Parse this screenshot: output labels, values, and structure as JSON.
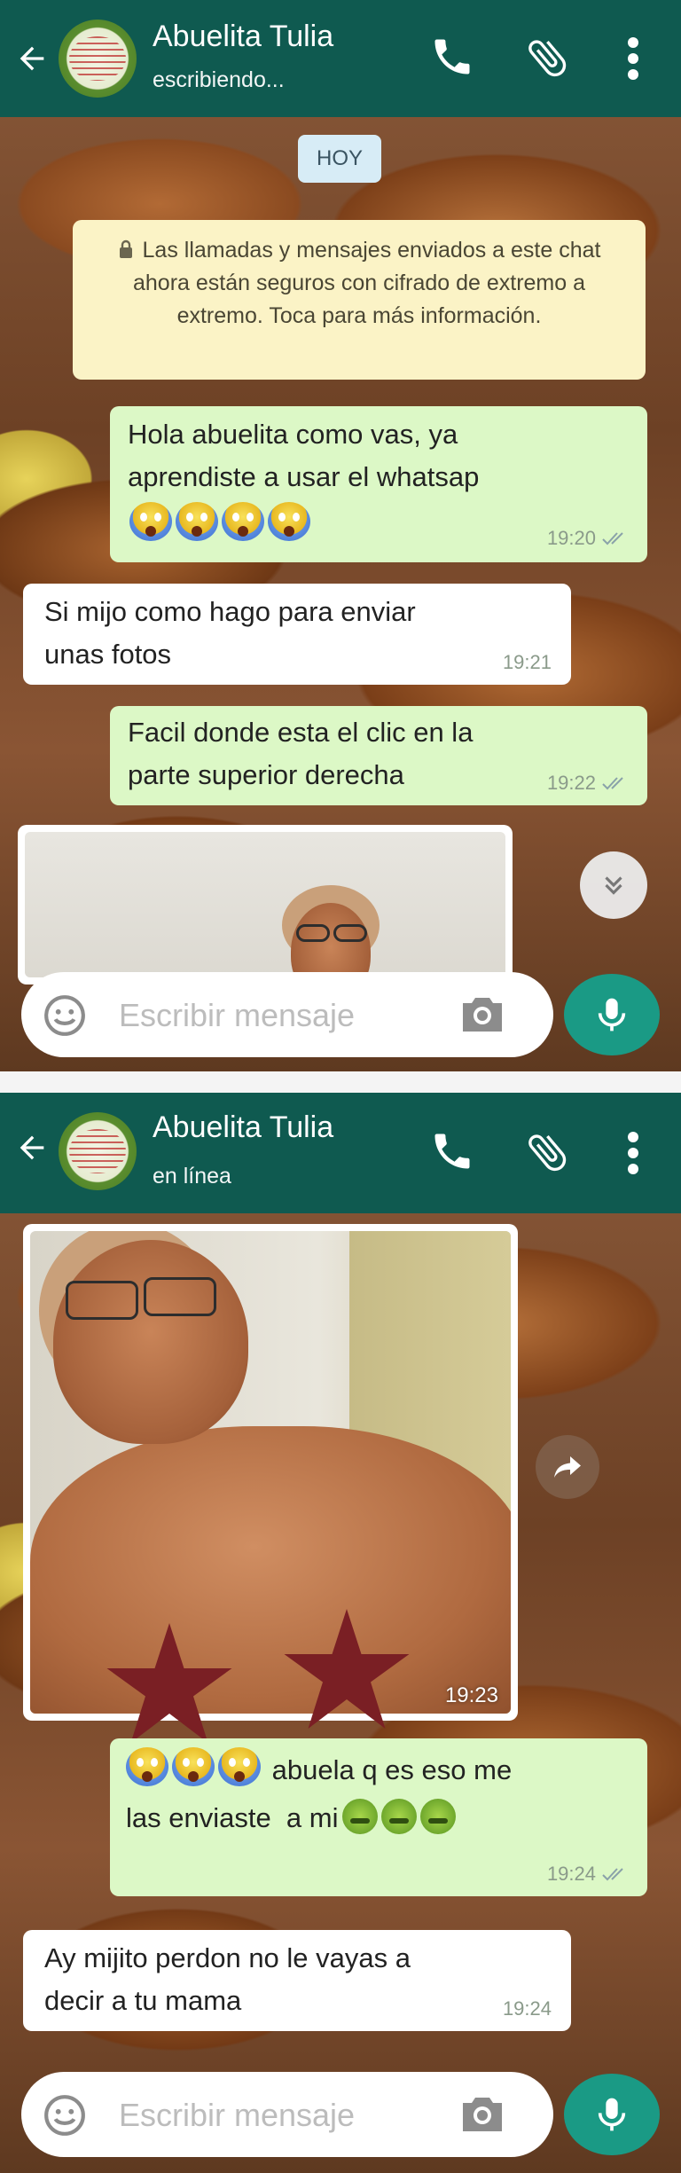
{
  "screen1": {
    "header": {
      "contact_name": "Abuelita Tulia",
      "status": "escribiendo..."
    },
    "date_chip": "HOY",
    "encryption_notice": "Las llamadas y mensajes enviados a este chat ahora están seguros con cifrado de extremo a extremo. Toca para más información.",
    "messages": [
      {
        "direction": "out",
        "lines": [
          "Hola abuelita como vas, ya",
          "aprendiste a usar el whatsap"
        ],
        "emoji_count": 4,
        "time": "19:20"
      },
      {
        "direction": "in",
        "lines": [
          "Si mijo como hago para enviar",
          "unas fotos"
        ],
        "time": "19:21"
      },
      {
        "direction": "out",
        "lines": [
          "Facil donde esta el clic en la",
          "parte superior derecha"
        ],
        "time": "19:22"
      }
    ],
    "composer": {
      "placeholder": "Escribir mensaje"
    }
  },
  "screen2": {
    "header": {
      "contact_name": "Abuelita Tulia",
      "status": "en línea"
    },
    "photo_message": {
      "time": "19:23"
    },
    "messages": [
      {
        "direction": "out",
        "line1": "abuela q es eso me",
        "line2": "las enviaste  a mi",
        "time": "19:24"
      },
      {
        "direction": "in",
        "lines": [
          "Ay mijito perdon no le vayas a",
          "decir a tu mama"
        ],
        "time": "19:24"
      }
    ],
    "composer": {
      "placeholder": "Escribir mensaje"
    }
  },
  "colors": {
    "header_bg": "#0f5a50",
    "outgoing_bubble": "#dcf8c6",
    "incoming_bubble": "#ffffff",
    "mic_button": "#1a9a85",
    "star": "#7a1f24"
  },
  "icons": [
    "back-arrow-icon",
    "call-icon",
    "attach-icon",
    "more-vert-icon",
    "lock-icon",
    "smiley-icon",
    "camera-icon",
    "mic-icon",
    "scroll-down-icon",
    "share-icon",
    "double-check-icon",
    "star-icon"
  ]
}
